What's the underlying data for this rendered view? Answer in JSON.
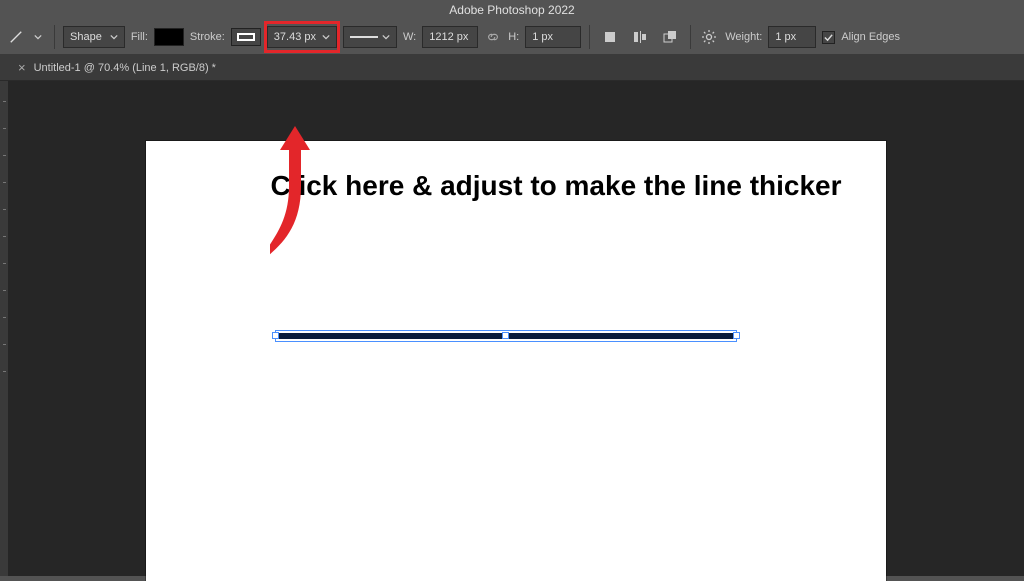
{
  "app": {
    "title": "Adobe Photoshop 2022"
  },
  "options": {
    "shape_mode": "Shape",
    "fill_label": "Fill:",
    "stroke_label": "Stroke:",
    "stroke_width": "37.43 px",
    "width_label": "W:",
    "width_value": "1212 px",
    "height_label": "H:",
    "height_value": "1 px",
    "weight_label": "Weight:",
    "weight_value": "1 px",
    "align_edges_label": "Align Edges",
    "align_edges_checked": true
  },
  "tab": {
    "title": "Untitled-1 @ 70.4% (Line 1, RGB/8) *"
  },
  "annotation": {
    "text": "Click here & adjust to make the line thicker",
    "highlight_color": "#e3262a"
  },
  "canvas": {
    "line_selected": true
  }
}
